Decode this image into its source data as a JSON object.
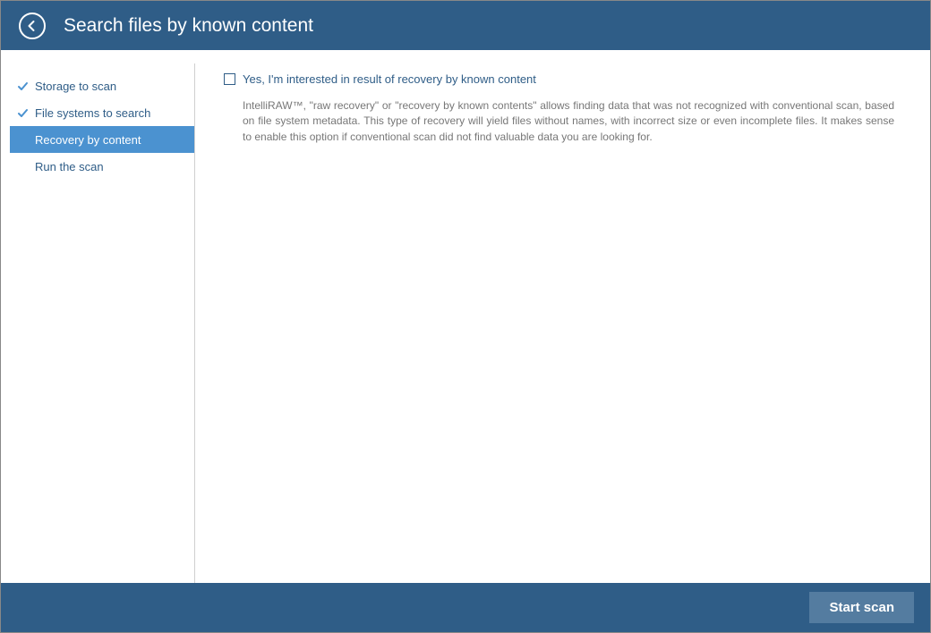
{
  "header": {
    "title": "Search files by known content"
  },
  "sidebar": {
    "items": [
      {
        "label": "Storage to scan",
        "checked": true,
        "selected": false
      },
      {
        "label": "File systems to search",
        "checked": true,
        "selected": false
      },
      {
        "label": "Recovery by content",
        "checked": false,
        "selected": true
      },
      {
        "label": "Run the scan",
        "checked": false,
        "selected": false
      }
    ]
  },
  "main": {
    "checkbox_label": "Yes, I'm interested in result of recovery by known content",
    "checkbox_checked": false,
    "description": "IntelliRAW™, \"raw recovery\" or \"recovery by known contents\" allows finding data that was not recognized with conventional scan, based on file system metadata. This type of recovery will yield files without names, with incorrect size or even incomplete files. It makes sense to enable this option if conventional scan did not find valuable data you are looking for."
  },
  "footer": {
    "start_label": "Start scan"
  }
}
